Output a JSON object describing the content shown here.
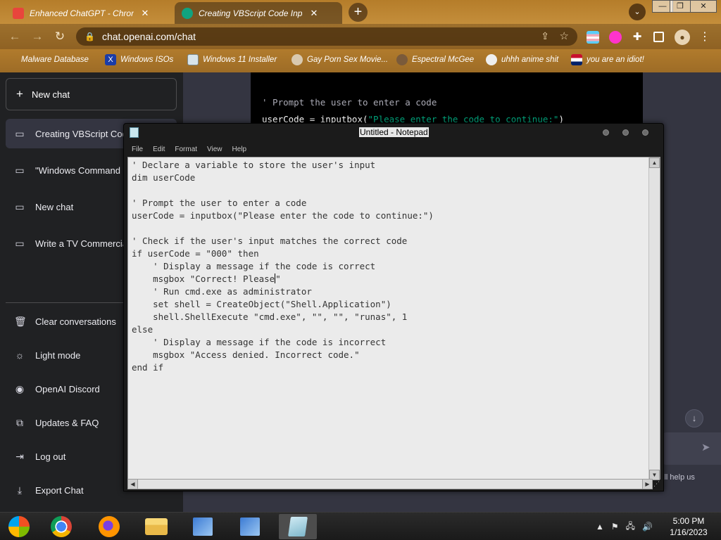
{
  "browser": {
    "tabs": [
      {
        "label": "Enhanced ChatGPT - Chrome Web",
        "close": "✕",
        "favicon_color": "#e8453c"
      },
      {
        "label": "Creating VBScript Code Input",
        "close": "✕",
        "favicon_color": "#10a37f"
      }
    ],
    "new_tab": "+",
    "tab_search": "⌄",
    "window_controls": {
      "minimize": "—",
      "maximize": "❐",
      "close": "✕"
    },
    "url": "chat.openai.com/chat",
    "bookmarks": [
      {
        "label": "Malware Database",
        "icon": "skull-icon"
      },
      {
        "label": "Windows ISOs",
        "icon": "x-icon"
      },
      {
        "label": "Windows 11 Installer",
        "icon": "image-icon"
      },
      {
        "label": "Gay Porn Sex Movie...",
        "icon": "site-icon"
      },
      {
        "label": "Espectral McGee",
        "icon": "site-icon"
      },
      {
        "label": "uhhh anime shit",
        "icon": "anime-icon"
      },
      {
        "label": "you are an idiot!",
        "icon": "flag-icon"
      }
    ]
  },
  "sidebar": {
    "new_chat": "New chat",
    "conversations": [
      {
        "label": "Creating VBScript Code Input",
        "active": true
      },
      {
        "label": "\"Windows Command Prompt\"",
        "active": false
      },
      {
        "label": "New chat",
        "active": false
      },
      {
        "label": "Write a TV Commercial",
        "active": false
      }
    ],
    "actions": [
      {
        "label": "Clear conversations",
        "icon": "trash-icon"
      },
      {
        "label": "Light mode",
        "icon": "sun-icon"
      },
      {
        "label": "OpenAI Discord",
        "icon": "discord-icon"
      },
      {
        "label": "Updates & FAQ",
        "icon": "external-link-icon"
      },
      {
        "label": "Log out",
        "icon": "logout-icon"
      },
      {
        "label": "Export Chat",
        "icon": "export-icon"
      }
    ]
  },
  "chat": {
    "code_comment": "' Prompt the user to enter a code",
    "code_line_prefix": "userCode = inputbox(",
    "code_line_string": "\"Please enter the code to continue:\"",
    "code_line_suffix": ")",
    "footer": "ill help us"
  },
  "notepad": {
    "title": "Untitled - Notepad",
    "menus": [
      "File",
      "Edit",
      "Format",
      "View",
      "Help"
    ],
    "text_before_caret": "' Declare a variable to store the user's input\ndim userCode\n\n' Prompt the user to enter a code\nuserCode = inputbox(\"Please enter the code to continue:\")\n\n' Check if the user's input matches the correct code\nif userCode = \"000\" then\n    ' Display a message if the code is correct\n    msgbox \"Correct! Please",
    "text_after_caret": "\"\n    ' Run cmd.exe as administrator\n    set shell = CreateObject(\"Shell.Application\")\n    shell.ShellExecute \"cmd.exe\", \"\", \"\", \"runas\", 1\nelse\n    ' Display a message if the code is incorrect\n    msgbox \"Access denied. Incorrect code.\"\nend if"
  },
  "taskbar": {
    "apps": [
      "Start",
      "Google Chrome",
      "Firefox",
      "File Explorer",
      "Setup",
      "Setup",
      "Notepad"
    ],
    "clock_time": "5:00 PM",
    "clock_date": "1/16/2023"
  }
}
